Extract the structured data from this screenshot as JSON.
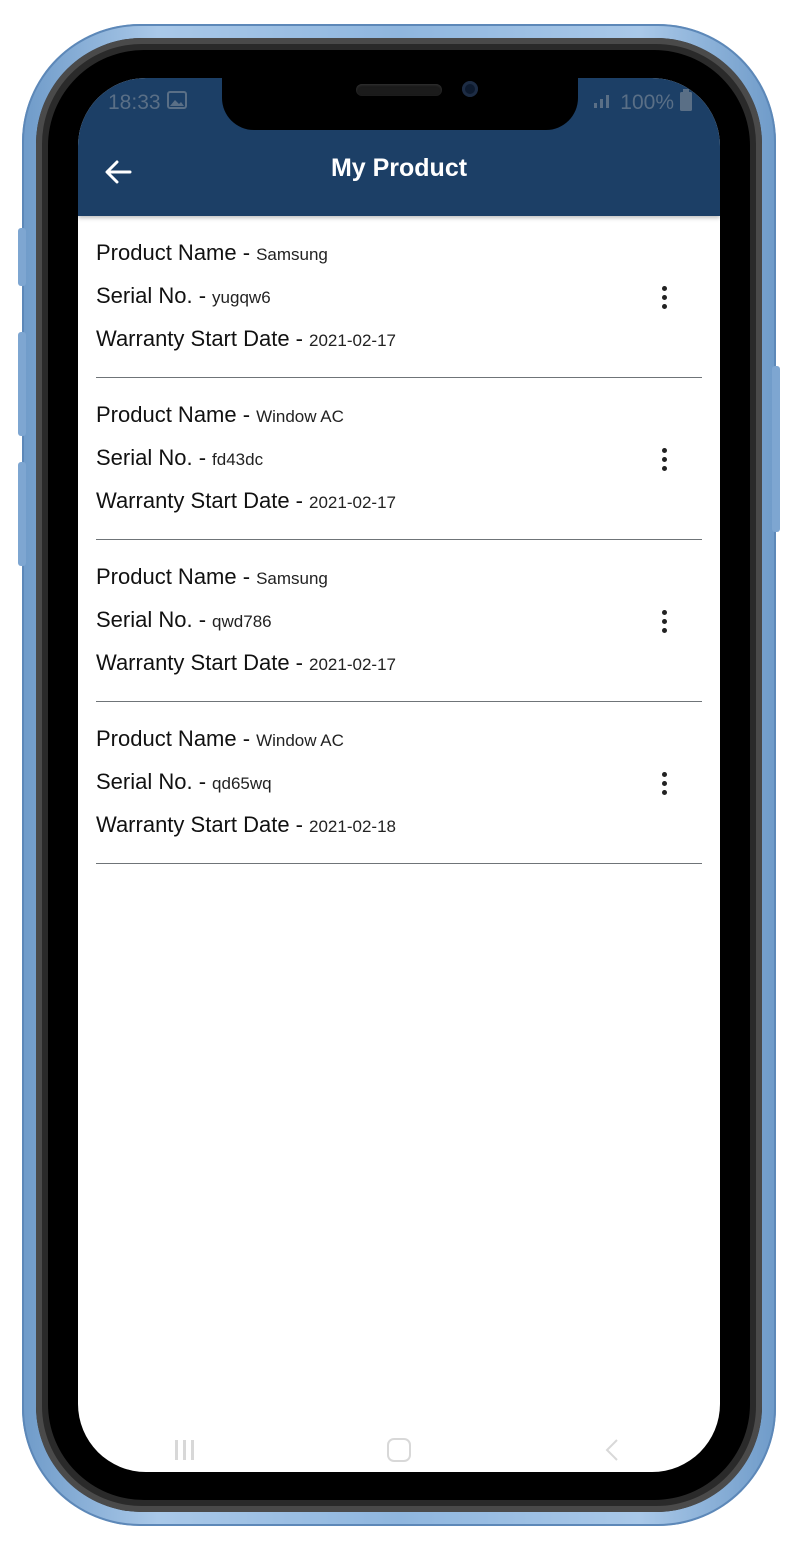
{
  "status_bar": {
    "time": "18:33",
    "battery": "100%"
  },
  "header": {
    "title": "My Product",
    "back_icon": "arrow-left-icon"
  },
  "labels": {
    "product_name": "Product Name -",
    "serial_no": "Serial No. -",
    "warranty_start_date": "Warranty Start Date -"
  },
  "products": [
    {
      "product_name": "Samsung",
      "serial_no": "yugqw6",
      "warranty_start_date": "2021-02-17"
    },
    {
      "product_name": "Window AC",
      "serial_no": "fd43dc",
      "warranty_start_date": "2021-02-17"
    },
    {
      "product_name": "Samsung",
      "serial_no": "qwd786",
      "warranty_start_date": "2021-02-17"
    },
    {
      "product_name": "Window AC",
      "serial_no": "qd65wq",
      "warranty_start_date": "2021-02-18"
    }
  ],
  "colors": {
    "appbar": "#1c3f66",
    "phone_frame": "#8fb6de",
    "divider": "#6f7478"
  }
}
